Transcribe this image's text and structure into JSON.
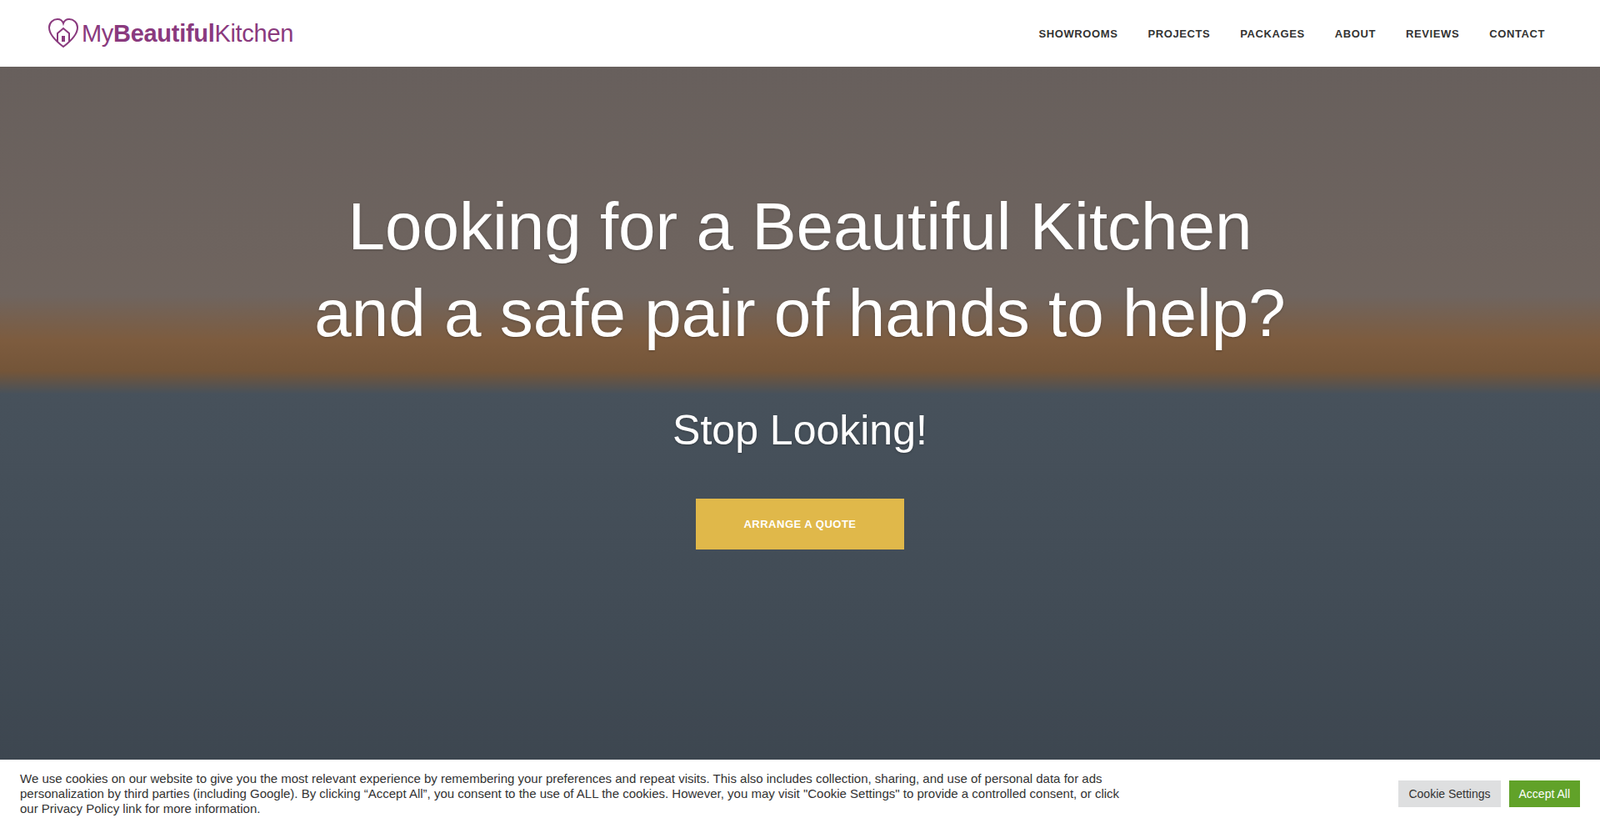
{
  "header": {
    "logo": {
      "prefix": "My",
      "bold": "Beautiful",
      "suffix": "Kitchen"
    },
    "nav": [
      "SHOWROOMS",
      "PROJECTS",
      "PACKAGES",
      "ABOUT",
      "REVIEWS",
      "CONTACT"
    ]
  },
  "hero": {
    "title_lines": [
      "Looking for a Beautiful Kitchen",
      "and a safe pair of hands to help?"
    ],
    "subtitle": "Stop Looking!",
    "button": "ARRANGE A QUOTE"
  },
  "cookie_bar": {
    "text": "We use cookies on our website to give you the most relevant experience by remembering your preferences and repeat visits. This also includes collection, sharing, and use of personal data for ads personalization by third parties (including Google). By clicking “Accept All”, you consent to the use of ALL the cookies. However, you may visit \"Cookie Settings\" to provide a controlled consent, or click our Privacy Policy link for more information.",
    "buttons": [
      "Cookie Settings",
      "Accept All"
    ]
  }
}
